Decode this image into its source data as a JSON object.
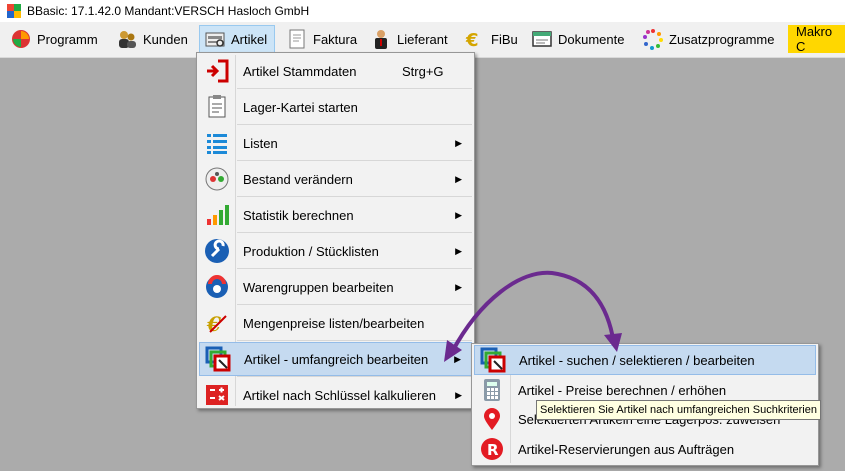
{
  "window": {
    "title": "BBasic: 17.1.42.0 Mandant:VERSCH Hasloch GmbH"
  },
  "menubar": [
    {
      "label": "Programm",
      "icon": "programm-icon"
    },
    {
      "label": "Kunden",
      "icon": "kunden-icon"
    },
    {
      "label": "Artikel",
      "icon": "artikel-icon"
    },
    {
      "label": "Faktura",
      "icon": "faktura-icon"
    },
    {
      "label": "Lieferant",
      "icon": "lieferant-icon"
    },
    {
      "label": "FiBu",
      "icon": "fibu-icon"
    },
    {
      "label": "Dokumente",
      "icon": "dokumente-icon"
    },
    {
      "label": "Zusatzprogramme",
      "icon": "zusatzprogramme-icon"
    },
    {
      "label": "Makro C"
    }
  ],
  "artikel_menu": [
    {
      "label": "Artikel Stammdaten",
      "shortcut": "Strg+G",
      "icon": "stammdaten-icon"
    },
    {
      "label": "Lager-Kartei starten",
      "icon": "lagerkartei-icon"
    },
    {
      "label": "Listen",
      "submenu_arrow": "▶",
      "icon": "listen-icon"
    },
    {
      "label": "Bestand verändern",
      "submenu_arrow": "▶",
      "icon": "bestand-icon"
    },
    {
      "label": "Statistik berechnen",
      "submenu_arrow": "▶",
      "icon": "statistik-icon"
    },
    {
      "label": "Produktion / Stücklisten",
      "submenu_arrow": "▶",
      "icon": "produktion-icon"
    },
    {
      "label": "Warengruppen bearbeiten",
      "submenu_arrow": "▶",
      "icon": "warengruppen-icon"
    },
    {
      "label": "Mengenpreise listen/bearbeiten",
      "icon": "mengenpreise-icon"
    },
    {
      "label": "Artikel - umfangreich bearbeiten",
      "submenu_arrow": "▶",
      "icon": "umfangreich-icon"
    },
    {
      "label": "Artikel nach Schlüssel kalkulieren",
      "submenu_arrow": "▶",
      "icon": "kalkulieren-icon"
    }
  ],
  "umfangreich_submenu": [
    {
      "label": "Artikel - suchen / selektieren / bearbeiten",
      "icon": "suchen-icon"
    },
    {
      "label": "Artikel  - Preise berechnen / erhöhen",
      "icon": "calculator-icon"
    },
    {
      "label": "Selektierten Artikeln eine Lagerpos. zuweisen",
      "icon": "location-pin-icon"
    },
    {
      "label": "Artikel-Reservierungen aus Aufträgen",
      "icon": "reservation-r-icon"
    }
  ],
  "tooltip": "Selektieren Sie Artikel nach umfangreichen Suchkriterien",
  "colors": {
    "menu_highlight": "#c5daf0",
    "annotation_arrow": "#6b2a8f",
    "makro_bg": "#ffd700"
  }
}
